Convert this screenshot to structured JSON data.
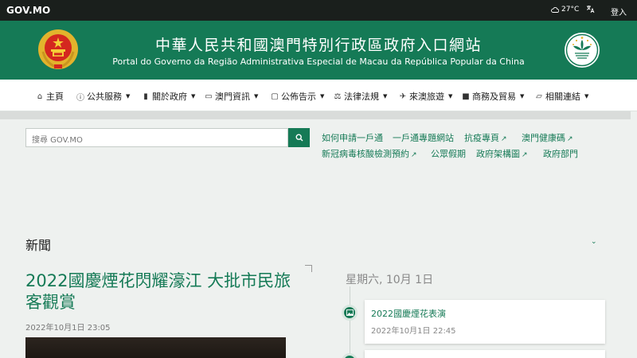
{
  "topbar": {
    "brand": "GOV.MO",
    "weather_icon": "cloud-icon",
    "temperature": "27°C",
    "language_icon": "translate-icon",
    "login": "登入"
  },
  "header": {
    "title_zh": "中華人民共和國澳門特別行政區政府入口網站",
    "title_pt": "Portal do Governo da Região Administrativa Especial de Macau da República Popular da China"
  },
  "nav": {
    "items": [
      {
        "icon": "home-icon",
        "label": "主頁",
        "dropdown": false
      },
      {
        "icon": "info-icon",
        "label": "公共服務",
        "dropdown": true
      },
      {
        "icon": "building-icon",
        "label": "關於政府",
        "dropdown": true
      },
      {
        "icon": "map-icon",
        "label": "澳門資訊",
        "dropdown": true
      },
      {
        "icon": "notice-icon",
        "label": "公佈告示",
        "dropdown": true
      },
      {
        "icon": "scale-icon",
        "label": "法律法規",
        "dropdown": true
      },
      {
        "icon": "plane-icon",
        "label": "來澳旅遊",
        "dropdown": true
      },
      {
        "icon": "briefcase-icon",
        "label": "商務及貿易",
        "dropdown": true
      },
      {
        "icon": "folder-icon",
        "label": "相關連結",
        "dropdown": true
      }
    ]
  },
  "search": {
    "placeholder": "搜尋 GOV.MO"
  },
  "quick_links": [
    {
      "label": "如何申請一戶通",
      "external": false
    },
    {
      "label": "一戶通專題網站",
      "external": false
    },
    {
      "label": "抗疫專頁",
      "external": true
    },
    {
      "label": "澳門健康碼",
      "external": true
    },
    {
      "label": "新冠病毒核酸檢測預約",
      "external": true
    },
    {
      "label": "公眾假期",
      "external": false
    },
    {
      "label": "政府架構圖",
      "external": true
    },
    {
      "label": "政府部門",
      "external": false
    }
  ],
  "news": {
    "heading": "新聞",
    "headline": "2022國慶煙花閃耀濠江 大批市民旅客觀賞",
    "headline_date": "2022年10月1日 23:05",
    "timeline_date": "星期六, 10月 1日",
    "items": [
      {
        "title": "2022國慶煙花表演",
        "date": "2022年10月1日 22:45",
        "icon": "image-icon"
      },
      {
        "title": "",
        "date": "",
        "icon": "image-icon"
      }
    ]
  },
  "colors": {
    "brand_green": "#157a56",
    "topbar": "#1a1f1c",
    "background": "#eef1ef"
  }
}
